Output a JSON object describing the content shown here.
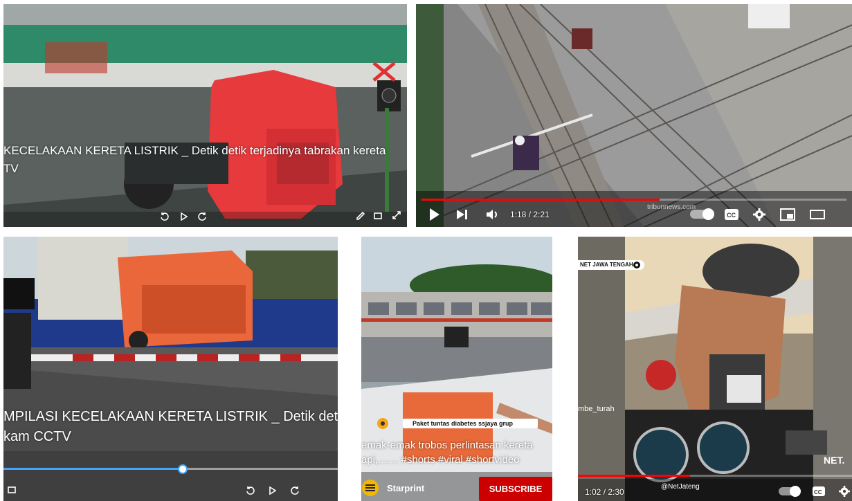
{
  "tile1": {
    "caption_line1": "KECELAKAAN KERETA LISTRIK _ Detik detik terjadinya tabrakan kereta",
    "caption_line2": "TV"
  },
  "tile2": {
    "time": "1:18 / 2:21",
    "watermark": "tribunnews.com",
    "progress": 0.56
  },
  "tile3": {
    "caption_line1": "MPILASI KECELAKAAN KERETA LISTRIK _ Detik detik",
    "caption_line2": "kam CCTV",
    "progress": 0.53
  },
  "tile4": {
    "ad_text": "Paket tuntas diabetes ssjaya grup",
    "title_line1": "emak-emak trobos perlintasan kereta",
    "title_line2": "api,....... #shorts #viral #shortvideo",
    "channel": "Starprint",
    "subscribe": "SUBSCRIBE"
  },
  "tile5": {
    "channel_badge": "NET JAWA TENGAH",
    "side_text": "mbe_turah",
    "corner_logo": "NET.",
    "time": "1:02 / 2:30",
    "handle": "@NetJateng",
    "progress": 0.41
  }
}
